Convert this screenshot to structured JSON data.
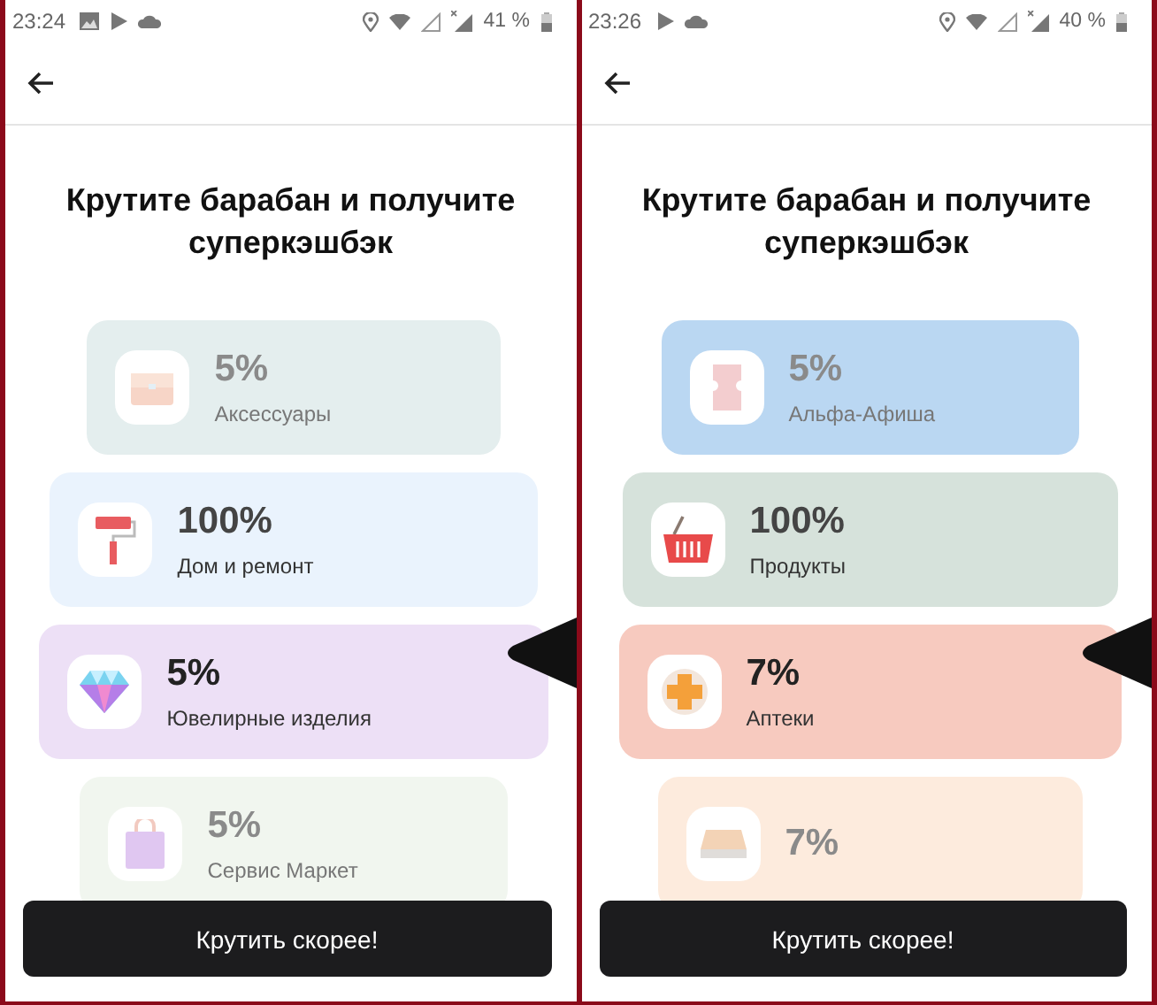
{
  "screens": [
    {
      "status_bar": {
        "time": "23:24",
        "battery": "41 %"
      },
      "title": "Крутите барабан и получите суперкэшбэк",
      "cards": [
        {
          "percent": "5%",
          "label": "Аксессуары",
          "color": "#e4eeee",
          "selected": false,
          "faded": true
        },
        {
          "percent": "100%",
          "label": "Дом и ремонт",
          "color": "#eaf3fd",
          "selected": false,
          "faded": false
        },
        {
          "percent": "5%",
          "label": "Ювелирные изделия",
          "color": "#ede0f6",
          "selected": true,
          "faded": false
        },
        {
          "percent": "5%",
          "label": "Сервис Маркет",
          "color": "#f1f6ef",
          "selected": false,
          "faded": true
        }
      ],
      "button": "Крутить скорее!"
    },
    {
      "status_bar": {
        "time": "23:26",
        "battery": "40 %"
      },
      "title": "Крутите барабан и получите суперкэшбэк",
      "cards": [
        {
          "percent": "5%",
          "label": "Альфа-Афиша",
          "color": "#bad7f2",
          "selected": false,
          "faded": true
        },
        {
          "percent": "100%",
          "label": "Продукты",
          "color": "#d6e2db",
          "selected": false,
          "faded": false
        },
        {
          "percent": "7%",
          "label": "Аптеки",
          "color": "#f7cabf",
          "selected": true,
          "faded": false
        },
        {
          "percent": "7%",
          "color": "#fdebdd",
          "selected": false,
          "faded": true
        }
      ],
      "button": "Крутить скорее!"
    }
  ]
}
